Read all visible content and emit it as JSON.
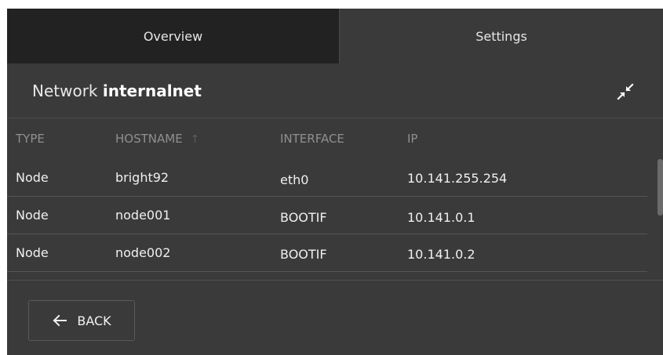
{
  "tabs": {
    "overview": "Overview",
    "settings": "Settings"
  },
  "header": {
    "prefix": "Network",
    "network_name": "internalnet",
    "collapse_icon": "collapse-arrows-icon"
  },
  "table": {
    "columns": [
      "TYPE",
      "HOSTNAME",
      "INTERFACE",
      "IP"
    ],
    "sort_icon": "arrow-up-icon",
    "rows": [
      [
        "Node",
        "bright92",
        "eth0",
        "10.141.255.254"
      ],
      [
        "Node",
        "node001",
        "BOOTIF",
        "10.141.0.1"
      ],
      [
        "Node",
        "node002",
        "BOOTIF",
        "10.141.0.2"
      ]
    ]
  },
  "footer": {
    "back_label": "BACK",
    "back_icon": "arrow-left-icon"
  },
  "colors": {
    "panel_bg": "#3a3a3a",
    "active_tab_bg": "#222222",
    "header_text": "#8f8f8f"
  }
}
